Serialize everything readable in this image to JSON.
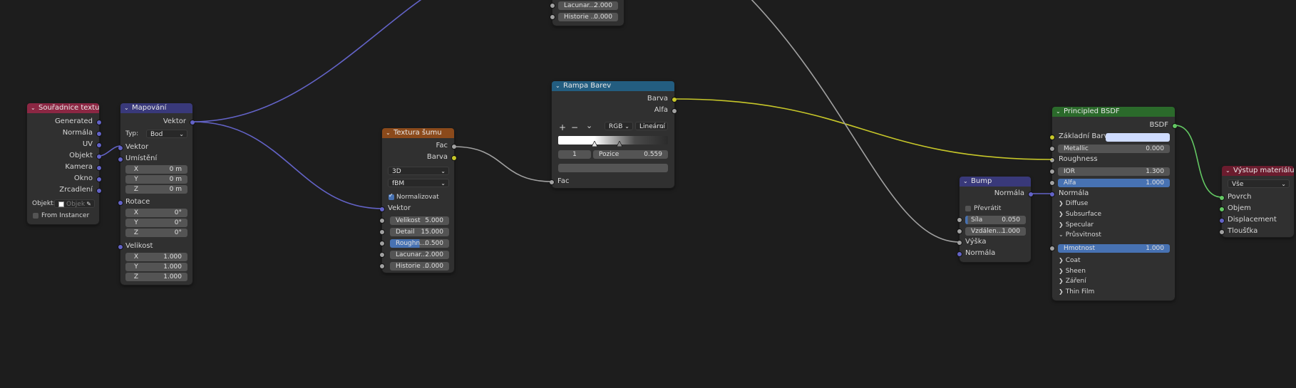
{
  "nodes": {
    "texcoord": {
      "title": "Souřadnice textury",
      "outputs": [
        "Generated",
        "Normála",
        "UV",
        "Objekt",
        "Kamera",
        "Okno",
        "Zrcadlení"
      ],
      "object_label": "Objekt:",
      "object_placeholder": "Objek",
      "from_instancer": "From Instancer",
      "color": "#8b2743"
    },
    "mapping": {
      "title": "Mapování",
      "output": "Vektor",
      "type_label": "Typ:",
      "type_value": "Bod",
      "vector_input": "Vektor",
      "location_label": "Umístění",
      "location": [
        {
          "axis": "X",
          "value": "0 m"
        },
        {
          "axis": "Y",
          "value": "0 m"
        },
        {
          "axis": "Z",
          "value": "0 m"
        }
      ],
      "rotation_label": "Rotace",
      "rotation": [
        {
          "axis": "X",
          "value": "0°"
        },
        {
          "axis": "Y",
          "value": "0°"
        },
        {
          "axis": "Z",
          "value": "0°"
        }
      ],
      "scale_label": "Velikost",
      "scale": [
        {
          "axis": "X",
          "value": "1.000"
        },
        {
          "axis": "Y",
          "value": "1.000"
        },
        {
          "axis": "Z",
          "value": "1.000"
        }
      ],
      "color": "#39397a"
    },
    "noise": {
      "title": "Textura šumu",
      "outputs": [
        "Fac",
        "Barva"
      ],
      "dimensions": "3D",
      "type": "fBM",
      "normalize_label": "Normalizovat",
      "normalize_checked": true,
      "vector_input": "Vektor",
      "fields": [
        {
          "label": "Velikost",
          "value": "5.000"
        },
        {
          "label": "Detail",
          "value": "15.000"
        },
        {
          "label": "Roughn...",
          "value": "0.500",
          "fill": 0.5
        },
        {
          "label": "Lacunar...",
          "value": "2.000"
        },
        {
          "label": "Historie ...",
          "value": "0.000"
        }
      ],
      "color": "#8b4a1b"
    },
    "noise_top": {
      "fields": [
        {
          "label": "Lacunar...",
          "value": "2.000"
        },
        {
          "label": "Historie ...",
          "value": "0.000"
        }
      ]
    },
    "ramp": {
      "title": "Rampa Barev",
      "outputs": [
        "Barva",
        "Alfa"
      ],
      "plus": "+",
      "minus": "−",
      "menu": "⌄",
      "color_mode": "RGB",
      "interpolation": "Lineární",
      "stop_index": "1",
      "position_label": "Pozice",
      "position_value": "0.559",
      "fac_input": "Fac",
      "color": "#235d80"
    },
    "bump": {
      "title": "Bump",
      "output": "Normála",
      "invert_label": "Převrátit",
      "fields": [
        {
          "label": "Síla",
          "value": "0.050"
        },
        {
          "label": "Vzdálen...",
          "value": "1.000"
        }
      ],
      "height_input": "Výška",
      "normal_input": "Normála",
      "color": "#39397a"
    },
    "bsdf": {
      "title": "Principled BSDF",
      "output": "BSDF",
      "base_color_label": "Základní Barva",
      "base_color_swatch": "#cfdcff",
      "metallic": {
        "label": "Metallic",
        "value": "0.000"
      },
      "roughness_label": "Roughness",
      "ior": {
        "label": "IOR",
        "value": "1.300"
      },
      "alpha": {
        "label": "Alfa",
        "value": "1.000"
      },
      "normal_label": "Normála",
      "panels": [
        "Diffuse",
        "Subsurface",
        "Specular"
      ],
      "transmission_label": "Průsvitnost",
      "weight": {
        "label": "Hmotnost",
        "value": "1.000"
      },
      "panels2": [
        "Coat",
        "Sheen",
        "Záření",
        "Thin Film"
      ],
      "color": "#2b6a2b"
    },
    "output": {
      "title": "Výstup materiálu",
      "target": "Vše",
      "inputs": [
        "Povrch",
        "Objem",
        "Displacement",
        "Tloušťka"
      ],
      "color": "#6b1c2e"
    }
  },
  "colors": {
    "background": "#1d1d1d",
    "vector_link": "#6363c7",
    "float_link": "#a1a1a1",
    "color_link": "#c7c729",
    "shader_link": "#63c763"
  }
}
